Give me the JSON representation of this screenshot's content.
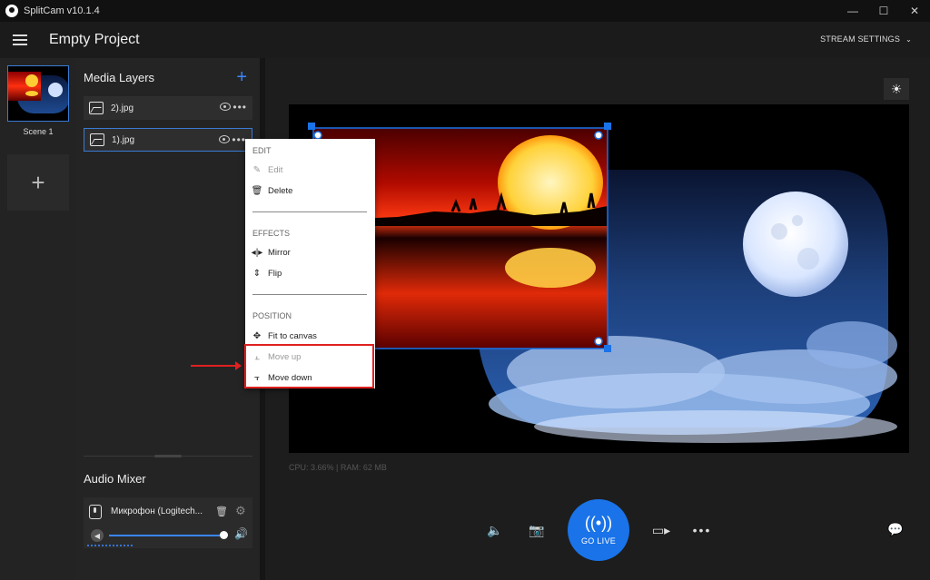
{
  "app": {
    "window_title": "SplitCam v10.1.4",
    "project_title": "Empty Project",
    "stream_settings_label": "STREAM SETTINGS"
  },
  "scenes": {
    "items": [
      {
        "label": "Scene 1"
      }
    ]
  },
  "media_layers": {
    "title": "Media Layers",
    "items": [
      {
        "name": "2).jpg",
        "selected": false
      },
      {
        "name": "1).jpg",
        "selected": true
      }
    ]
  },
  "context_menu": {
    "sections": {
      "edit": "EDIT",
      "effects": "EFFECTS",
      "position": "POSITION"
    },
    "items": {
      "edit": {
        "label": "Edit",
        "icon": "pencil-icon",
        "enabled": false
      },
      "delete": {
        "label": "Delete",
        "icon": "trash-icon",
        "enabled": true
      },
      "mirror": {
        "label": "Mirror",
        "icon": "mirror-icon",
        "enabled": true
      },
      "flip": {
        "label": "Flip",
        "icon": "flip-icon",
        "enabled": true
      },
      "fit": {
        "label": "Fit to canvas",
        "icon": "move-arrows-icon",
        "enabled": true
      },
      "move_up": {
        "label": "Move up",
        "icon": "move-up-icon",
        "enabled": false
      },
      "move_down": {
        "label": "Move down",
        "icon": "move-down-icon",
        "enabled": true
      }
    }
  },
  "audio_mixer": {
    "title": "Audio Mixer",
    "device": {
      "name": "Микрофон  (Logitech...",
      "volume": 0.9
    }
  },
  "stats": "CPU: 3.66% | RAM: 62 MB",
  "controls": {
    "go_live_label": "GO LIVE"
  },
  "colors": {
    "accent": "#1a73e8",
    "selection": "#3a7bd5",
    "annotation": "#e02020"
  }
}
